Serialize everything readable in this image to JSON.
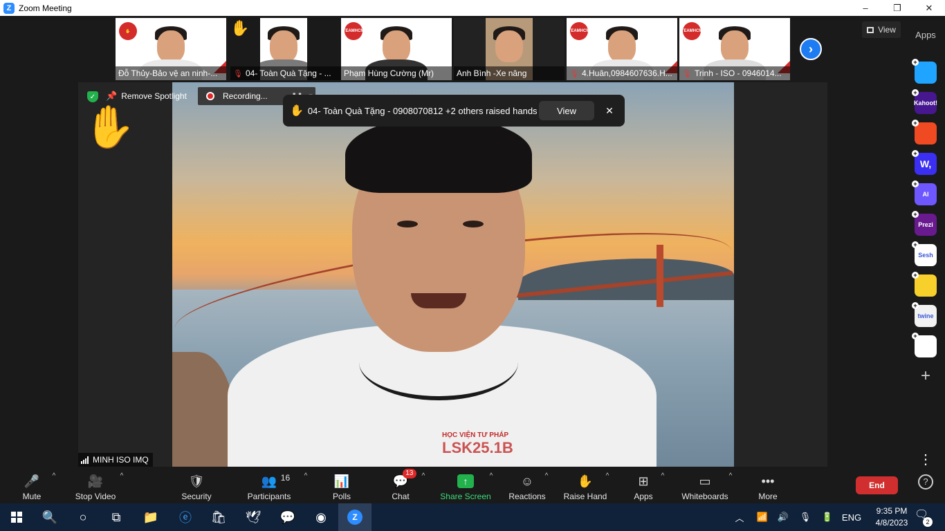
{
  "window": {
    "title": "Zoom Meeting",
    "minimize": "–",
    "maximize": "❐",
    "close": "✕"
  },
  "gallery": {
    "tiles": [
      {
        "name": "Đỗ Thủy-Bảo vệ an ninh-...",
        "muted": false
      },
      {
        "name": "04- Toàn Quà Tặng - ...",
        "muted": true
      },
      {
        "name": "Phạm Hùng Cường (Mr)",
        "muted": false
      },
      {
        "name": "Anh Bình -Xe nâng",
        "muted": false
      },
      {
        "name": "4.Huân,0984607636.H...",
        "muted": true
      },
      {
        "name": "Trinh - ISO - 0946014...",
        "muted": true
      }
    ],
    "badge_text": "TEAMHCM",
    "view_label": "View"
  },
  "spotlight": {
    "remove_label": "Remove Spotlight",
    "recording_label": "Recording...",
    "speaker_name": "MINH ISO IMQ",
    "shirt_text": "HỌC VIỆN TƯ PHÁP",
    "shirt_text_big": "LSK25.1B"
  },
  "notification": {
    "message": "04- Toàn Quà Tặng - 0908070812 +2 others raised hands",
    "view_label": "View",
    "close_label": "✕"
  },
  "apps_panel": {
    "title": "Apps",
    "apps": [
      {
        "name": "",
        "color": "#1fa5ff"
      },
      {
        "name": "Kahoot!",
        "color": "#46178f"
      },
      {
        "name": "",
        "color": "#f04a23"
      },
      {
        "name": "W,",
        "color": "#3a2ff2"
      },
      {
        "name": "AI",
        "color": "#6f57ff"
      },
      {
        "name": "Prezi",
        "color": "#6a1a8f"
      },
      {
        "name": "Sesh",
        "color": "#ffffff"
      },
      {
        "name": "",
        "color": "#f7d02c"
      },
      {
        "name": "twine",
        "color": "#f2f2f2"
      },
      {
        "name": "",
        "color": "#ffffff"
      }
    ],
    "add_label": "+",
    "more_label": "⋮",
    "help_label": "?"
  },
  "toolbar": {
    "mute": "Mute",
    "stop_video": "Stop Video",
    "security": "Security",
    "participants": "Participants",
    "participants_count": "16",
    "polls": "Polls",
    "chat": "Chat",
    "chat_badge": "13",
    "share_screen": "Share Screen",
    "reactions": "Reactions",
    "raise_hand": "Raise Hand",
    "apps": "Apps",
    "whiteboards": "Whiteboards",
    "more": "More",
    "end": "End"
  },
  "taskbar": {
    "language": "ENG",
    "time": "9:35 PM",
    "date": "4/8/2023",
    "notifications": "2"
  }
}
